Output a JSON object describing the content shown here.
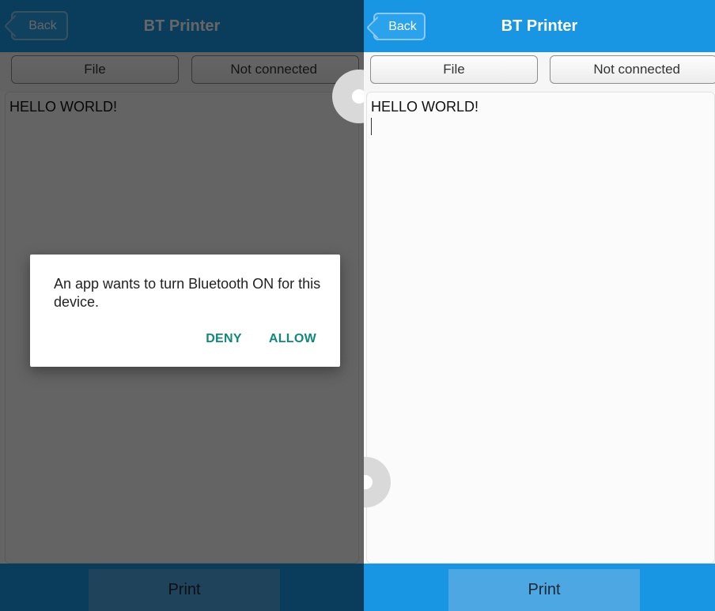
{
  "app": {
    "title": "BT Printer",
    "back_label": "Back",
    "file_label": "File",
    "connection_status": "Not connected",
    "editor_text": "HELLO WORLD!",
    "print_label": "Print"
  },
  "dialog": {
    "message": "An app wants to turn Bluetooth ON for this device.",
    "deny_label": "DENY",
    "allow_label": "ALLOW"
  },
  "colors": {
    "header_blue": "#1996e3",
    "print_button": "#4ca7e3",
    "dialog_action": "#10897a"
  }
}
